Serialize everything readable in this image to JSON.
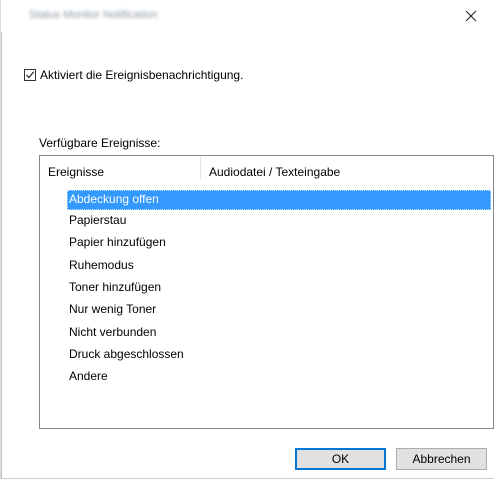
{
  "window": {
    "title": "Status Monitor Notification",
    "close_icon": "close-icon"
  },
  "checkbox": {
    "label": "Aktiviert die Ereignisbenachrichtigung.",
    "checked": true
  },
  "events_section": {
    "label": "Verfügbare Ereignisse:",
    "columns": [
      "Ereignisse",
      "Audiodatei / Texteingabe"
    ],
    "items": [
      {
        "name": "Abdeckung offen",
        "audio": "",
        "selected": true
      },
      {
        "name": "Papierstau",
        "audio": ""
      },
      {
        "name": "Papier hinzufügen",
        "audio": ""
      },
      {
        "name": "Ruhemodus",
        "audio": ""
      },
      {
        "name": "Toner hinzufügen",
        "audio": ""
      },
      {
        "name": "Nur wenig Toner",
        "audio": ""
      },
      {
        "name": "Nicht verbunden",
        "audio": ""
      },
      {
        "name": "Druck abgeschlossen",
        "audio": ""
      },
      {
        "name": "Andere",
        "audio": ""
      }
    ]
  },
  "buttons": {
    "ok": "OK",
    "cancel": "Abbrechen"
  },
  "colors": {
    "selection": "#3399ff",
    "default_button_border": "#0078d7"
  }
}
